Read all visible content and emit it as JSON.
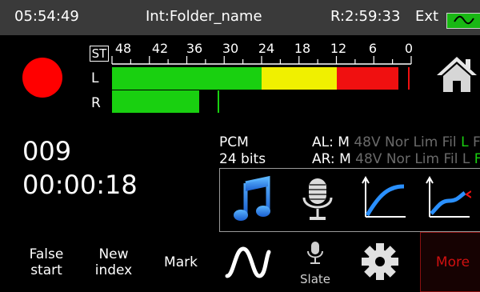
{
  "status": {
    "clock": "05:54:49",
    "folder": "Int:Folder_name",
    "remaining": "R:2:59:33",
    "power": "Ext",
    "accent": "#19b814"
  },
  "meter": {
    "mode_label": "ST",
    "scale": [
      "48",
      "42",
      "36",
      "30",
      "24",
      "18",
      "12",
      "6",
      "0"
    ],
    "channels": [
      {
        "label": "L",
        "level_db": -2,
        "peak_db": -0.5
      },
      {
        "label": "R",
        "level_db": -34,
        "peak_db": -31
      }
    ],
    "colors": {
      "green": "#19d010",
      "yellow": "#f0f000",
      "red": "#f01010",
      "peak": "#19d010"
    }
  },
  "recording": {
    "take": "009",
    "elapsed": "00:00:18",
    "format": "PCM",
    "bits": "24 bits"
  },
  "inputs": [
    {
      "prefix": "AL:",
      "mode": "M",
      "phantom": "48V",
      "nor": "Nor",
      "lim": "Lim",
      "fil": "Fil",
      "active": "L",
      "extra": "F"
    },
    {
      "prefix": "AR:",
      "mode": "M",
      "phantom": "48V",
      "nor": "Nor",
      "lim": "Lim",
      "fil": "Fil",
      "active": "L",
      "extra": "F"
    }
  ],
  "icons": {
    "home": "home-icon",
    "music": "music-note-icon",
    "microphone": "microphone-icon",
    "curve1": "compression-curve-icon",
    "curve2": "limiter-curve-icon"
  },
  "buttons": {
    "false_start": [
      "False",
      "start"
    ],
    "new_index": [
      "New",
      "index"
    ],
    "mark": "Mark",
    "slate": "Slate",
    "more": "More",
    "more_color": "#d01010"
  }
}
